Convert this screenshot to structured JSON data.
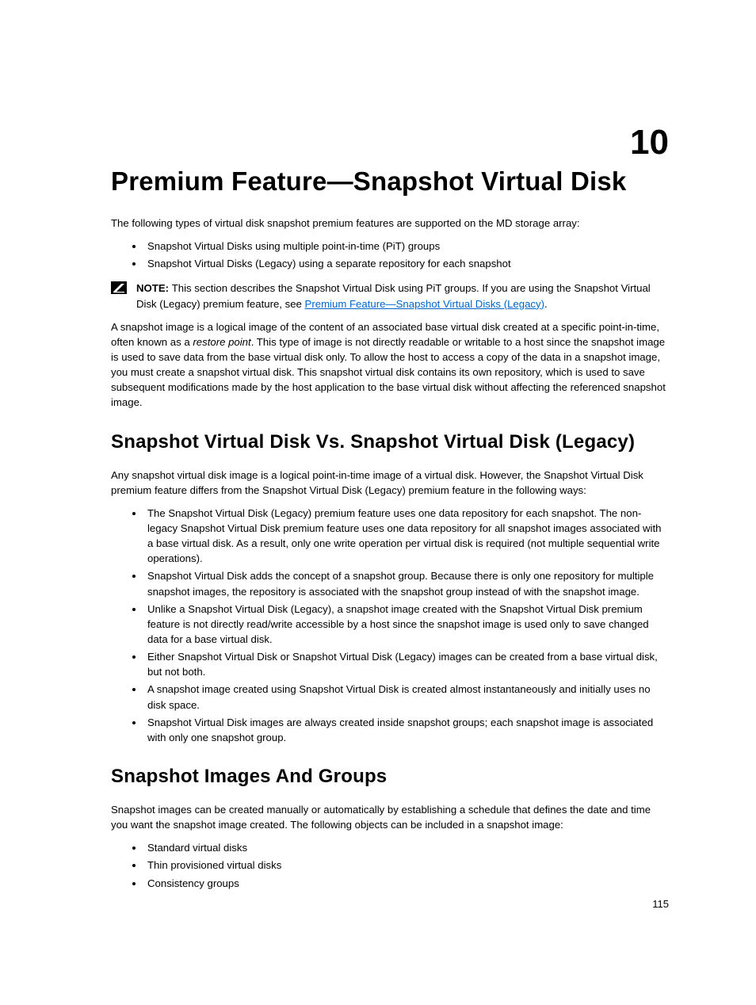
{
  "chapter_number": "10",
  "title": "Premium Feature—Snapshot Virtual Disk",
  "intro_para": "The following types of virtual disk snapshot premium features are supported on the MD storage array:",
  "intro_bullets": [
    "Snapshot Virtual Disks using multiple point-in-time (PiT) groups",
    "Snapshot Virtual Disks (Legacy) using a separate repository for each snapshot"
  ],
  "note": {
    "label": "NOTE: ",
    "pre": "This section describes the Snapshot Virtual Disk using PiT groups. If you are using the Snapshot Virtual Disk (Legacy) premium feature, see ",
    "link_text": "Premium Feature—Snapshot Virtual Disks (Legacy)",
    "post": "."
  },
  "para2_pre": "A snapshot image is a logical image of the content of an associated base virtual disk created at a specific point-in-time, often known as a ",
  "para2_italic": "restore point",
  "para2_post": ". This type of image is not directly readable or writable to a host since the snapshot image is used to save data from the base virtual disk only. To allow the host to access a copy of the data in a snapshot image, you must create a snapshot virtual disk. This snapshot virtual disk contains its own repository, which is used to save subsequent modifications made by the host application to the base virtual disk without affecting the referenced snapshot image.",
  "section1_title": "Snapshot Virtual Disk Vs. Snapshot Virtual Disk (Legacy)",
  "section1_para": "Any snapshot virtual disk image is a logical point-in-time image of a virtual disk. However, the Snapshot Virtual Disk premium feature differs from the Snapshot Virtual Disk (Legacy) premium feature in the following ways:",
  "section1_bullets": [
    "The Snapshot Virtual Disk (Legacy) premium feature uses one data repository for each snapshot. The non-legacy Snapshot Virtual Disk premium feature uses one data repository for all snapshot images associated with a base virtual disk. As a result, only one write operation per virtual disk is required (not multiple sequential write operations).",
    "Snapshot Virtual Disk adds the concept of a snapshot group. Because there is only one repository for multiple snapshot images, the repository is associated with the snapshot group instead of with the snapshot image.",
    "Unlike a Snapshot Virtual Disk (Legacy), a snapshot image created with the Snapshot Virtual Disk premium feature is not directly read/write accessible by a host since the snapshot image is used only to save changed data for a base virtual disk.",
    "Either Snapshot Virtual Disk or Snapshot Virtual Disk (Legacy) images can be created from a base virtual disk, but not both.",
    "A snapshot image created using Snapshot Virtual Disk is created almost instantaneously and initially uses no disk space.",
    "Snapshot Virtual Disk images are always created inside snapshot groups; each snapshot image is associated with only one snapshot group."
  ],
  "section2_title": "Snapshot Images And Groups",
  "section2_para": "Snapshot images can be created manually or automatically by establishing a schedule that defines the date and time you want the snapshot image created. The following objects can be included in a snapshot image:",
  "section2_bullets": [
    "Standard virtual disks",
    "Thin provisioned virtual disks",
    "Consistency groups"
  ],
  "page_number": "115"
}
